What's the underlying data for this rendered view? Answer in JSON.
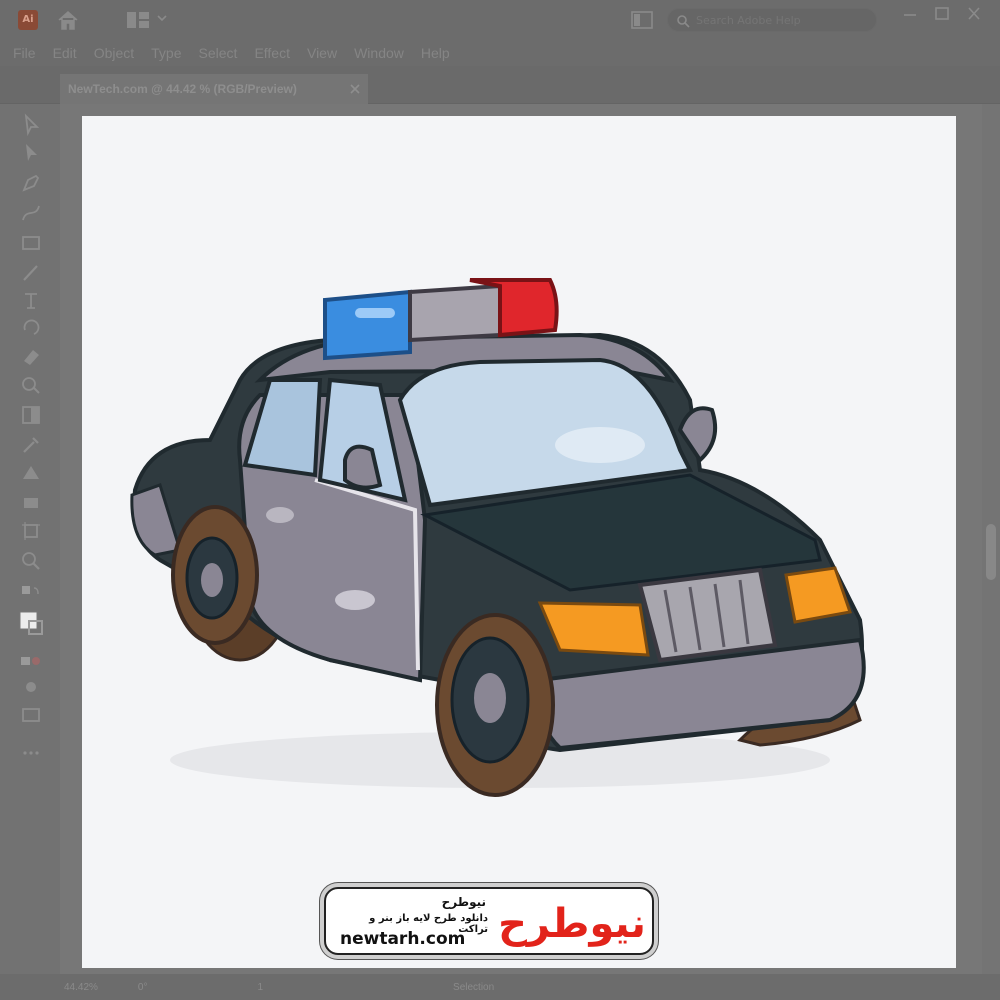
{
  "app": {
    "logo_text": "Ai"
  },
  "search": {
    "placeholder": "Search Adobe Help"
  },
  "menu": [
    "File",
    "Edit",
    "Object",
    "Type",
    "Select",
    "Effect",
    "View",
    "Window",
    "Help"
  ],
  "document": {
    "tab_label": "NewTech.com @ 44.42 % (RGB/Preview)"
  },
  "status": {
    "zoom": "44.42%",
    "rotation": "0°",
    "artboard": "1",
    "tool": "Selection"
  },
  "watermark": {
    "brand_fa": "نیوطرح",
    "tagline_fa": "دانلود طرح لایه باز بنر و تراکت",
    "url": "newtarh.com",
    "logo_fa": "نیوطرح"
  },
  "colors": {
    "car_body_dark": "#2f3a3f",
    "car_body_grey": "#8a8694",
    "light_blue": "#3a8de0",
    "light_red": "#e0262c",
    "headlight": "#f59a22",
    "tire": "#6b4a30",
    "logo_red": "#e2231a"
  }
}
